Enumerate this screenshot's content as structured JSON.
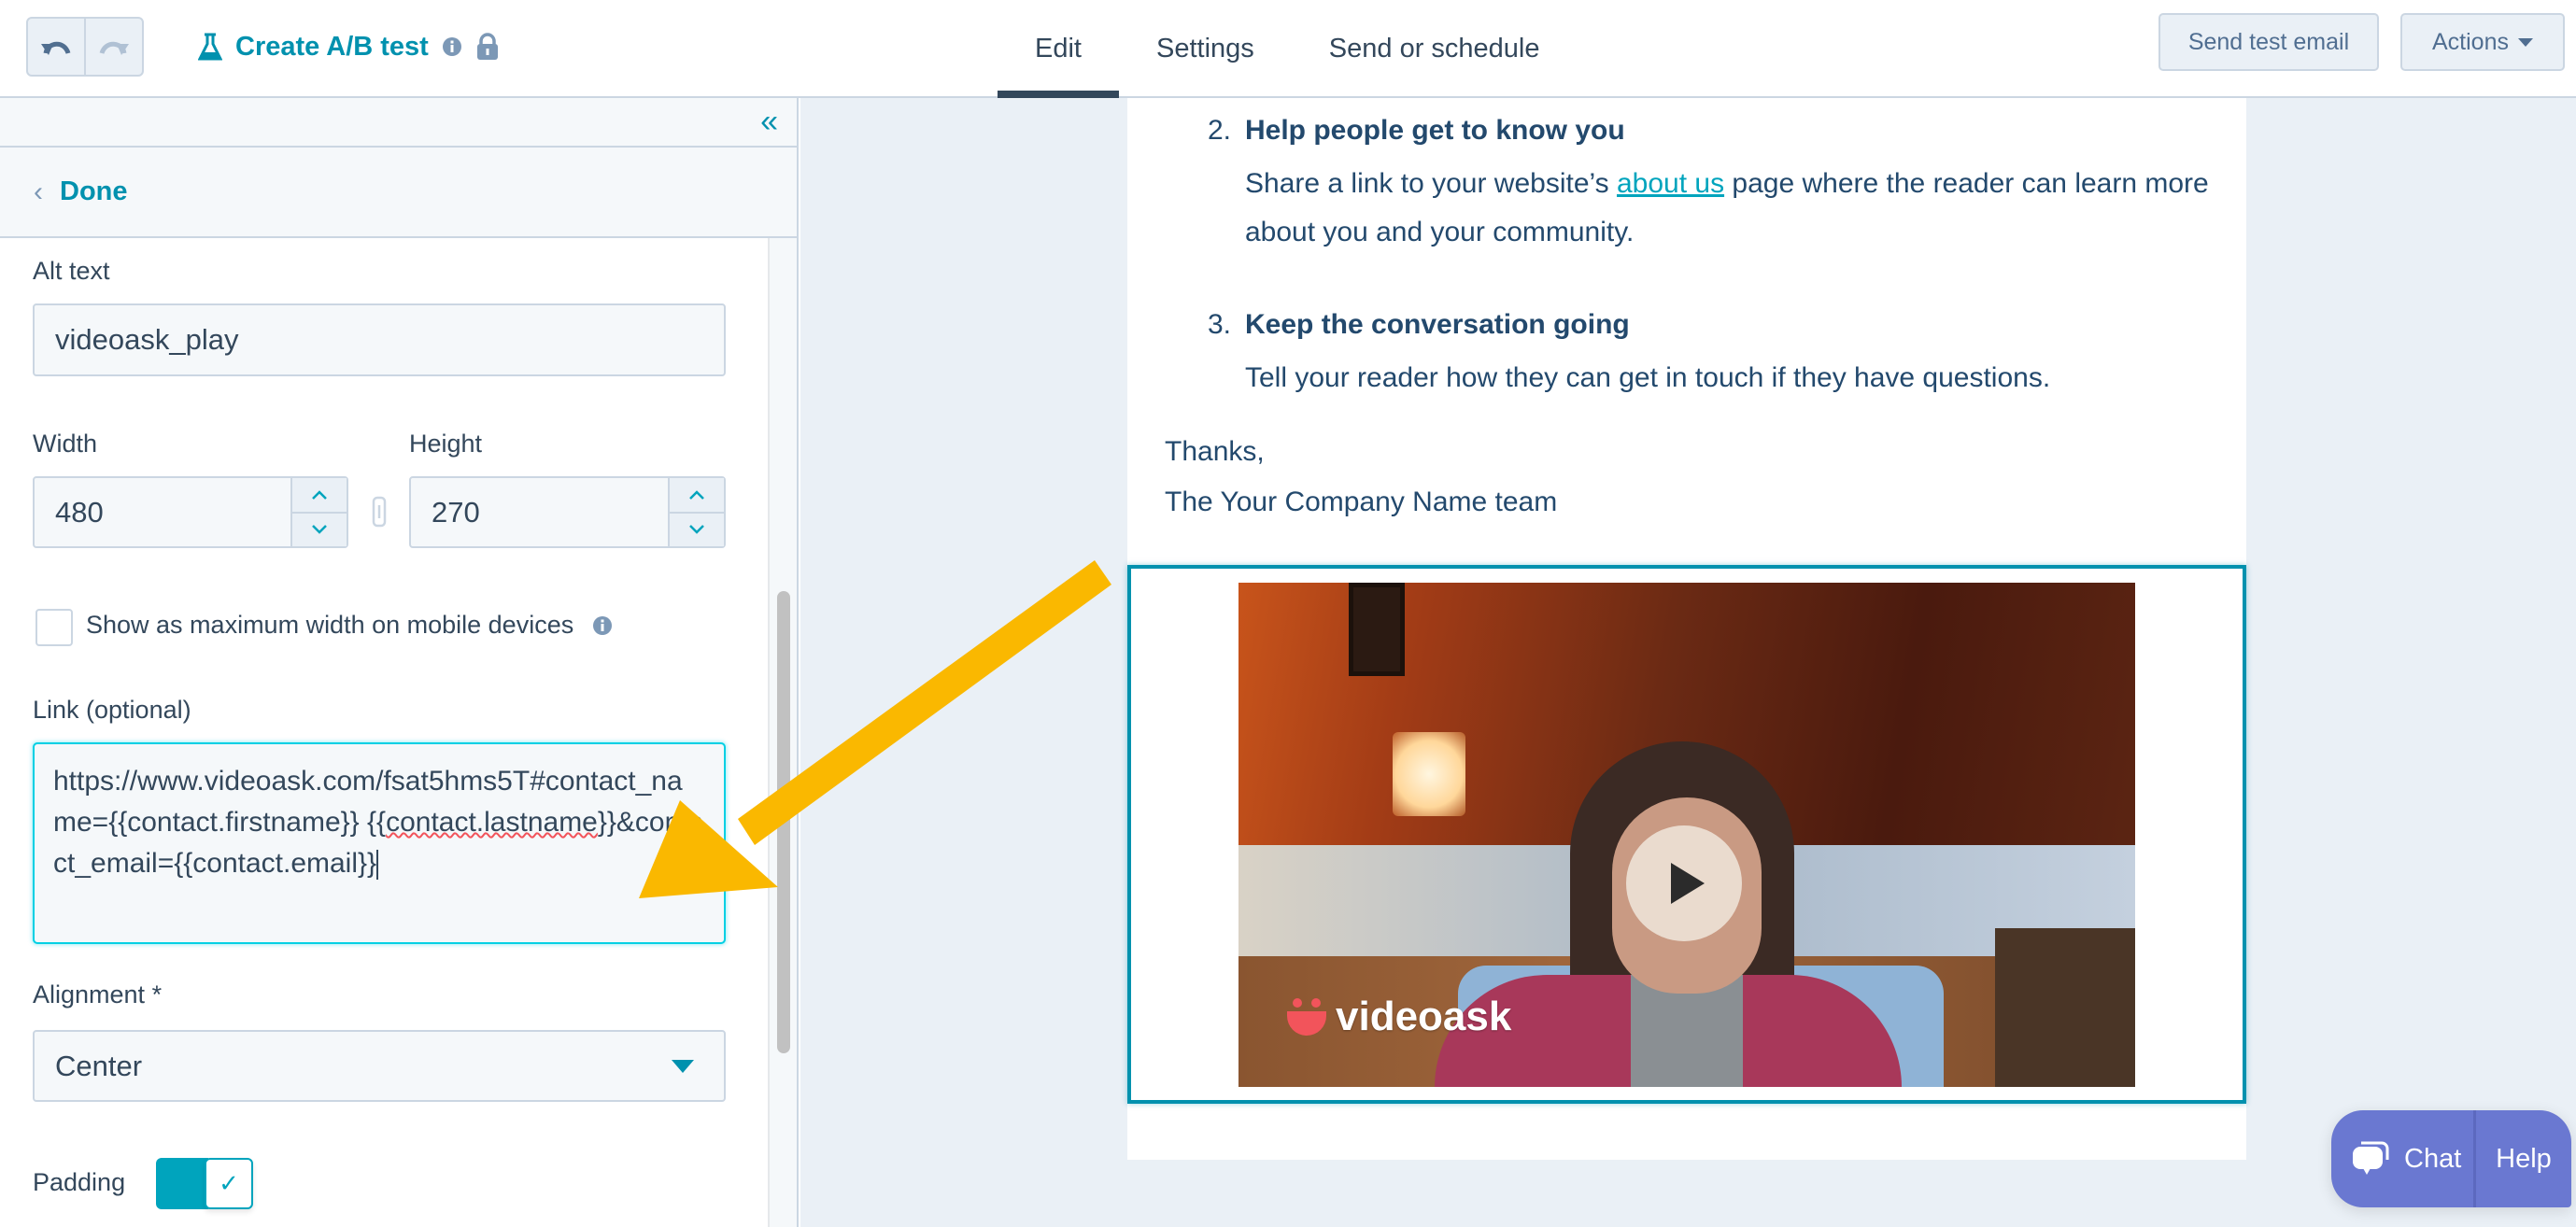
{
  "topbar": {
    "undo_icon": "undo-icon",
    "redo_icon": "redo-icon",
    "ab_test": {
      "icon": "flask-icon",
      "label": "Create A/B test",
      "info_icon": "info-icon",
      "lock_icon": "lock-icon"
    },
    "tabs": [
      {
        "label": "Edit",
        "active": true
      },
      {
        "label": "Settings",
        "active": false
      },
      {
        "label": "Send or schedule",
        "active": false
      }
    ],
    "send_test_label": "Send test email",
    "actions_label": "Actions"
  },
  "sidebar": {
    "collapse_icon": "double-chevron-left-icon",
    "done_label": "Done",
    "alt_text": {
      "label": "Alt text",
      "value": "videoask_play"
    },
    "width": {
      "label": "Width",
      "value": "480"
    },
    "height": {
      "label": "Height",
      "value": "270"
    },
    "lock_ratio_icon": "link-icon",
    "mobile_max_width": {
      "label": "Show as maximum width on mobile devices",
      "checked": false
    },
    "link": {
      "label": "Link (optional)",
      "value_part1": "https://www.videoask.com/fsat5hms5T#contact_name={{contact.firstname}} {{",
      "value_spell": "contact.lastname",
      "value_part2": "}}&contact_email={{contact.email}}"
    },
    "alignment": {
      "label": "Alignment *",
      "value": "Center"
    },
    "padding": {
      "label": "Padding",
      "enabled": true
    }
  },
  "email": {
    "items": [
      {
        "num": "2.",
        "heading": "Help people get to know you",
        "body_before": "Share a link to your website’s ",
        "link_text": "about us",
        "body_after": " page where the reader can learn more about you and your community."
      },
      {
        "num": "3.",
        "heading": "Keep the conversation going",
        "body": "Tell your reader how they can get in touch if they have questions."
      }
    ],
    "signoff": "Thanks,",
    "signature": "The Your Company Name team",
    "image": {
      "alt": "videoask_play",
      "brand": "videoask",
      "play_icon": "play-icon"
    }
  },
  "chat_widget": {
    "chat_label": "Chat",
    "help_label": "Help",
    "chat_icon": "chat-bubble-icon"
  },
  "colors": {
    "accent": "#0091ae",
    "text_primary": "#33475b",
    "highlight_arrow": "#fab800",
    "chat_bg": "#6a78d1"
  }
}
